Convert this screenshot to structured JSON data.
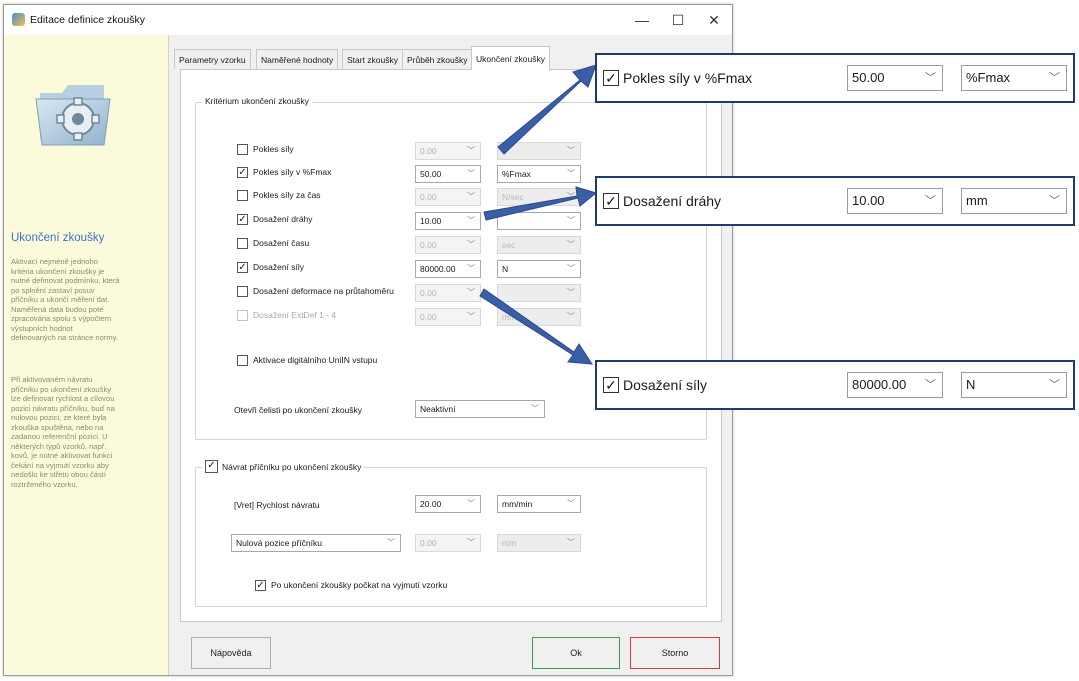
{
  "window": {
    "title": "Editace definice zkoušky",
    "controls": {
      "minimize": "—",
      "maximize": "☐",
      "close": "✕"
    }
  },
  "sidebar": {
    "heading": "Ukončení zkoušky",
    "paragraph1": "Aktivací nejméně jednoho\nkritéria ukončení zkoušky je\nnutné definovat podmínku, která\npo splnění zastaví posuv\npříčníku a ukončí měření dat.\nNaměřená data budou poté\nzpracována spolu s výpočtem\nvýstupních hodnot\ndefinovaných na stránce normy.",
    "paragraph2": "Při aktivovaném návratu\npříčníku po ukončení zkoušky\nlze definovat rychlost a cílovou\npozici návratu příčníku, buď na\nnulovou pozici, ze které byla\nzkouška spuštěna, nebo na\nzadanou referenční pozici. U\nněkterých typů vzorků, např.\nkovů, je nutné aktivovat funkci\nčekání na vyjmutí vzorku aby\nnedošlo ke střetu obou částí\nroztrženého vzorku."
  },
  "tabs": [
    "Parametry vzorku",
    "Naměřené hodnoty",
    "Start zkoušky",
    "Průběh zkoušky",
    "Ukončení zkoušky"
  ],
  "criteria": {
    "legend": "Kritérium ukončení zkoušky",
    "rows": [
      {
        "label": "Pokles síly",
        "checked": false,
        "enabled": true,
        "value": "0.00",
        "unit": ""
      },
      {
        "label": "Pokles síly v %Fmax",
        "checked": true,
        "enabled": true,
        "value": "50.00",
        "unit": "%Fmax"
      },
      {
        "label": "Pokles síly za čas",
        "checked": false,
        "enabled": true,
        "value": "0.00",
        "unit": "N/sec"
      },
      {
        "label": "Dosažení dráhy",
        "checked": true,
        "enabled": true,
        "value": "10.00",
        "unit": ""
      },
      {
        "label": "Dosažení času",
        "checked": false,
        "enabled": true,
        "value": "0.00",
        "unit": "sec"
      },
      {
        "label": "Dosažení síly",
        "checked": true,
        "enabled": true,
        "value": "80000.00",
        "unit": "N"
      },
      {
        "label": "Dosažení deformace na průtahoměru",
        "checked": false,
        "enabled": true,
        "value": "0.00",
        "unit": ""
      },
      {
        "label": "Dosažení ExtDef 1 - 4",
        "checked": false,
        "enabled": false,
        "value": "0.00",
        "unit": "mm"
      }
    ],
    "digital_input_label": "Aktivace digitálního UniIN vstupu",
    "open_jaws_label": "Otevři čelisti po ukončení zkoušky",
    "open_jaws_value": "Neaktivní"
  },
  "return": {
    "legend": "Návrat příčníku po ukončení zkoušky",
    "legend_checked": true,
    "speed_label": "[Vret]  Rychlost návratu",
    "speed_value": "20.00",
    "speed_unit": "mm/min",
    "position_value": "Nulová pozice příčníku",
    "position_amount": "0.00",
    "position_unit": "mm",
    "wait_label": "Po ukončení zkoušky počkat na vyjmutí vzorku",
    "wait_checked": true
  },
  "buttons": {
    "help": "Nápověda",
    "ok": "Ok",
    "cancel": "Storno"
  },
  "callouts": [
    {
      "label": "Pokles síly v %Fmax",
      "value": "50.00",
      "unit": "%Fmax"
    },
    {
      "label": "Dosažení dráhy",
      "value": "10.00",
      "unit": "mm"
    },
    {
      "label": "Dosažení síly",
      "value": "80000.00",
      "unit": "N"
    }
  ],
  "colors": {
    "arrow": "#3b5ea8",
    "sidebar_bg": "#fbfbdb",
    "heading": "#3d73c2",
    "cancel_border": "#d13b3b",
    "ok_border": "#3c9a4e"
  }
}
